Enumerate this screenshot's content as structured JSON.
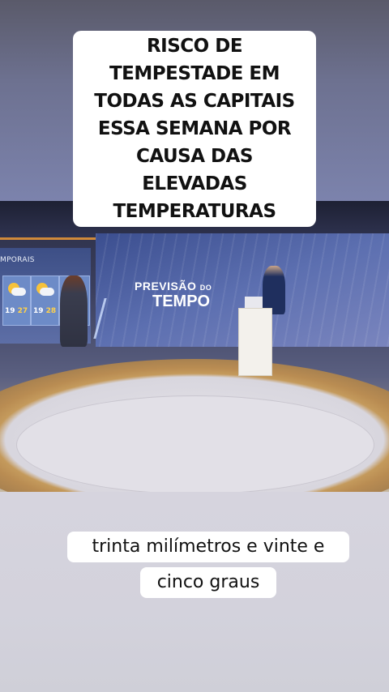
{
  "top_caption": {
    "lines": [
      "RISCO DE",
      "TEMPESTADE EM",
      "TODAS AS CAPITAIS",
      "ESSA SEMANA POR",
      "CAUSA DAS",
      "ELEVADAS",
      "TEMPERATURAS"
    ]
  },
  "studio": {
    "left_screen_title": "MPORAIS",
    "weather_cards": [
      {
        "min": "19",
        "max": "27"
      },
      {
        "min": "19",
        "max": "28"
      }
    ],
    "main_screen_title_line1": "PREVISÃO",
    "main_screen_title_small": "DO",
    "main_screen_title_line2": "TEMPO"
  },
  "bottom_caption": {
    "line1": "trinta milímetros e vinte e",
    "line2": "cinco graus"
  },
  "colors": {
    "caption_bg": "#ffffff",
    "studio_accent": "#d08a3a",
    "screen_blue": "#5c6fb0"
  }
}
